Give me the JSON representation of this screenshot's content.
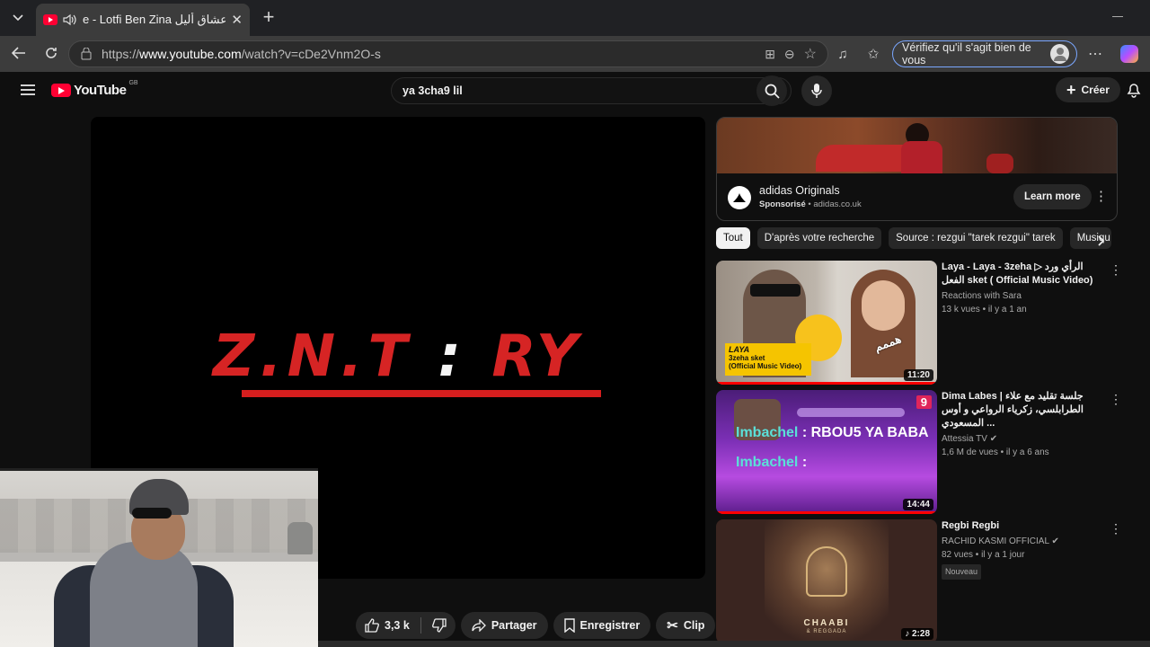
{
  "browser": {
    "tab_title": "e - Lotfi Ben Zina يا عشاق أليل",
    "url_prefix": "https://",
    "url_host": "www.youtube.com",
    "url_path": "/watch?v=cDe2Vnm2O-s",
    "verify_label": "Vérifiez qu'il s'agit bien de vous"
  },
  "youtube": {
    "logo": "YouTube",
    "region": "GB",
    "search_value": "ya 3cha9 lil",
    "create_label": "Créer"
  },
  "player": {
    "znt": "Z.N.T",
    "colon": ":",
    "ry": "RY"
  },
  "actions": {
    "likes": "3,3 k",
    "share": "Partager",
    "save": "Enregistrer",
    "clip": "Clip"
  },
  "ad": {
    "channel": "adidas Originals",
    "sponsored": "Sponsorisé",
    "domain": "adidas.co.uk",
    "cta": "Learn more"
  },
  "chips": [
    "Tout",
    "D'après votre recherche",
    "Source : rezgui \"tarek rezgui\" tarek",
    "Musiqu"
  ],
  "videos": [
    {
      "title": "Laya - Laya - 3zeha ▷ الرأي ورد الفعل sket ( Official Music Video)",
      "channel": "Reactions with Sara",
      "meta": "13 k vues • il y a 1 an",
      "duration": "11:20",
      "thumb_caption": "LAYA",
      "thumb_sub": "3zeha sket",
      "thumb_sub2": "(Official Music Video)",
      "thumb_arabic": "هممم"
    },
    {
      "title": "Dima Labes | جلسة تقليد مع علاء الطرابلسي، زكرياء الرواعي و أوس المسعودي ...",
      "channel": "Attessia TV",
      "meta": "1,6 M de vues • il y a 6 ans",
      "duration": "14:44",
      "badge": "9",
      "overlay_name": "Imbachel",
      "overlay_text1": ": RBOU5 YA BABA",
      "overlay_text2": ":"
    },
    {
      "title": "Regbi Regbi",
      "channel": "RACHID KASMI OFFICIAL",
      "meta": "82 vues • il y a 1 jour",
      "badge": "Nouveau",
      "duration": "2:28",
      "thumb_caption": "CHAABI",
      "thumb_sub": "& REGGADA"
    }
  ]
}
